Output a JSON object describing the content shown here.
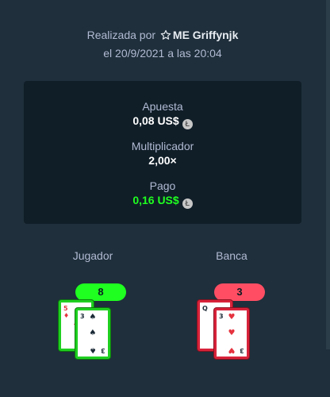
{
  "header": {
    "made_by_prefix": "Realizada por",
    "username": "ME Griffynjk",
    "date_line": "el 20/9/2021 a las 20:04"
  },
  "stats": {
    "bet_label": "Apuesta",
    "bet_value": "0,08 US$",
    "multiplier_label": "Multiplicador",
    "multiplier_value": "2,00×",
    "payout_label": "Pago",
    "payout_value": "0,16 US$",
    "coin_icon": "litecoin-icon"
  },
  "player": {
    "title": "Jugador",
    "score": "8",
    "cards": [
      {
        "rank": "5",
        "suit": "♦"
      },
      {
        "rank": "3",
        "suit": "♠"
      }
    ]
  },
  "banker": {
    "title": "Banca",
    "score": "3",
    "cards": [
      {
        "rank": "Q",
        "suit": "♠"
      },
      {
        "rank": "3",
        "suit": "♥"
      }
    ]
  },
  "colors": {
    "background": "#1f2f3b",
    "panel": "#101e28",
    "win": "#1fff20",
    "lose": "#ff4e63"
  }
}
